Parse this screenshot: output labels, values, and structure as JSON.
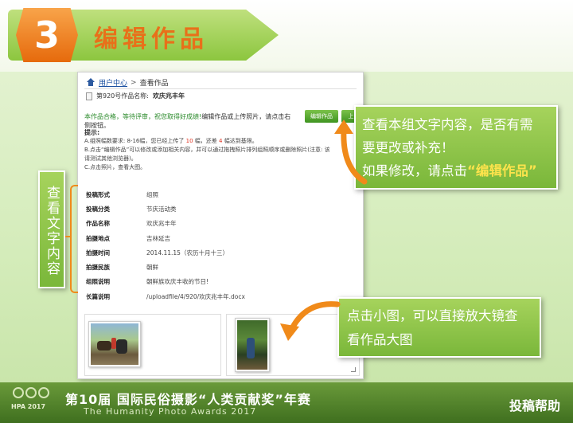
{
  "header": {
    "step_number": "3",
    "step_title": "编辑作品"
  },
  "panel": {
    "breadcrumb_home": "用户中心",
    "breadcrumb_sep": ">",
    "breadcrumb_current": "查看作品",
    "work_no_label": "第920号作品名称:",
    "work_name": "欢庆兆丰年",
    "status_ok": "本作品合格，等待评审，祝您取得好成绩!",
    "status_rest": "编辑作品或上传照片，请点击右侧按钮。",
    "edit_button": "编辑作品",
    "upload_button": "上",
    "tips_title": "提示:",
    "tip_a_pre": "A.组照幅数要求: 8-16幅，您已经上传了",
    "tip_a_count": "10",
    "tip_a_mid": "幅，还差",
    "tip_a_remain": "4",
    "tip_a_post": "幅达到基限。",
    "tip_b": "B.点击“编辑作品”可以修改或添加相关内容，并可以通过拖拽照片排列组照顺序或删除照片(注意: 该",
    "tip_b2": "请测试其他浏览器)。",
    "tip_c": "C.点击照片，查看大图。",
    "rows": [
      {
        "k": "投稿形式",
        "v": "组照"
      },
      {
        "k": "投稿分类",
        "v": "节庆活动类"
      },
      {
        "k": "作品名称",
        "v": "欢庆兆丰年"
      },
      {
        "k": "拍摄地点",
        "v": "吉林延吉"
      },
      {
        "k": "拍摄时间",
        "v": "2014.11.15（农历十月十三）"
      },
      {
        "k": "拍摄民族",
        "v": "朝鲜"
      },
      {
        "k": "组照说明",
        "v": "朝鲜族欢庆丰收的节日!"
      },
      {
        "k": "长篇说明",
        "v": "/uploadfile/4/920/欢庆兆丰年.docx"
      }
    ]
  },
  "callouts": {
    "top_line1": "查看本组文字内容，是否有需",
    "top_line2": "要更改或补充！",
    "top_line3": "如果修改，请点击",
    "top_em": "“编辑作品”",
    "side": "查看文字内容",
    "bottom_line1": "点击小图，可以直接放大镜查",
    "bottom_line2": "看作品大图"
  },
  "footer": {
    "logo_text": "HPA 2017",
    "title": "第10届 国际民俗摄影“人类贡献奖”年赛",
    "subtitle": "The Humanity Photo Awards 2017",
    "help": "投稿帮助"
  },
  "colors": {
    "accent_orange": "#e8701a",
    "green": "#7ab73a",
    "highlight": "#fde34c"
  }
}
